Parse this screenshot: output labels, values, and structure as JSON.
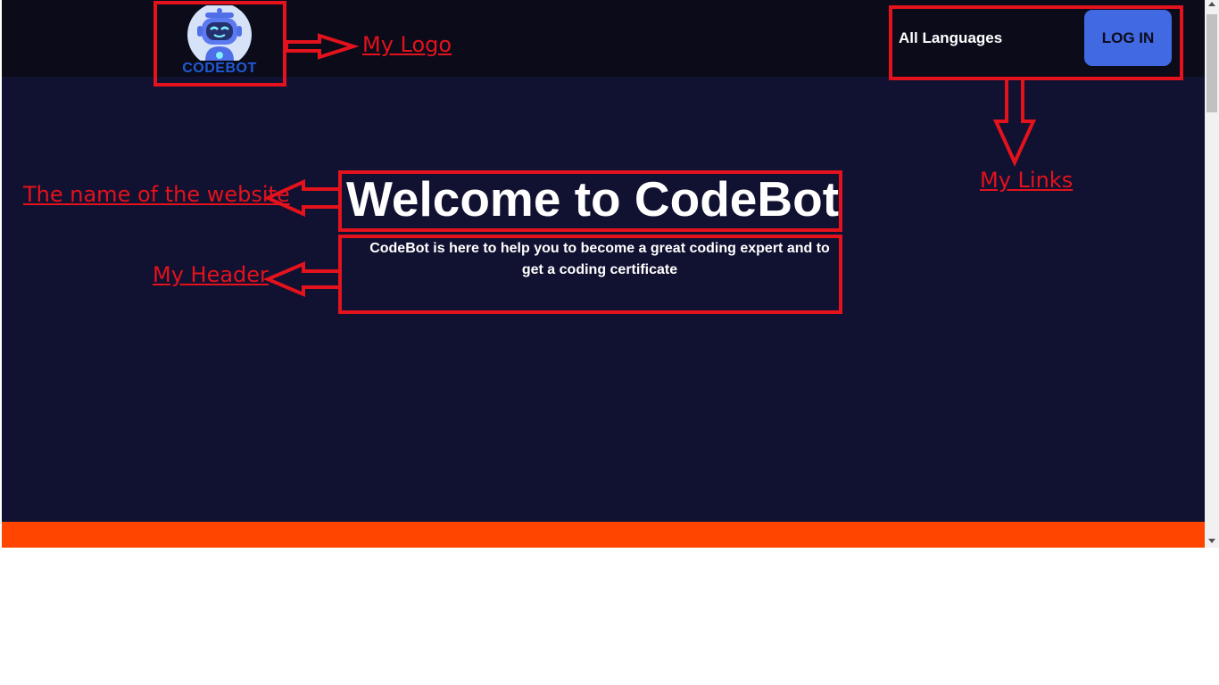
{
  "header": {
    "logo_text": "CODEBOT",
    "nav_languages": "All Languages",
    "login_label": "LOG IN"
  },
  "hero": {
    "title": "Welcome to CodeBot",
    "subtitle": "CodeBot is here to help you to become a great coding expert and to get a coding certificate"
  },
  "annotations": {
    "logo_label": "My Logo",
    "links_label": "My Links",
    "site_name_label": "The name of the website",
    "header_label": "My Header"
  },
  "colors": {
    "page_background": "#111131",
    "topbar_background": "#0b0b1a",
    "login_button": "#4169e1",
    "footer_strip": "#ff4500",
    "annotation": "#e3121c"
  },
  "icons": {
    "logo": "robot-icon"
  }
}
